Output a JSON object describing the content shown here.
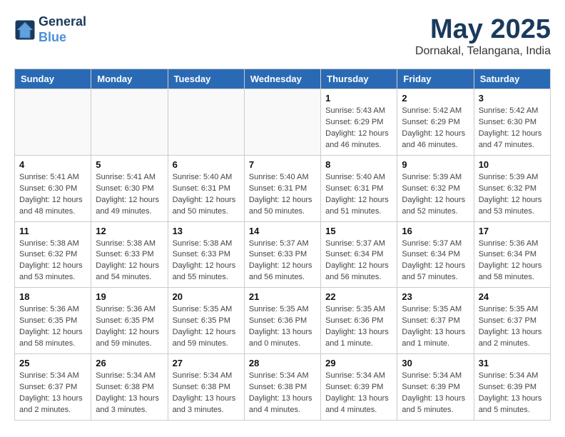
{
  "header": {
    "logo_line1": "General",
    "logo_line2": "Blue",
    "month": "May 2025",
    "location": "Dornakal, Telangana, India"
  },
  "weekdays": [
    "Sunday",
    "Monday",
    "Tuesday",
    "Wednesday",
    "Thursday",
    "Friday",
    "Saturday"
  ],
  "weeks": [
    [
      {
        "day": "",
        "info": ""
      },
      {
        "day": "",
        "info": ""
      },
      {
        "day": "",
        "info": ""
      },
      {
        "day": "",
        "info": ""
      },
      {
        "day": "1",
        "info": "Sunrise: 5:43 AM\nSunset: 6:29 PM\nDaylight: 12 hours\nand 46 minutes."
      },
      {
        "day": "2",
        "info": "Sunrise: 5:42 AM\nSunset: 6:29 PM\nDaylight: 12 hours\nand 46 minutes."
      },
      {
        "day": "3",
        "info": "Sunrise: 5:42 AM\nSunset: 6:30 PM\nDaylight: 12 hours\nand 47 minutes."
      }
    ],
    [
      {
        "day": "4",
        "info": "Sunrise: 5:41 AM\nSunset: 6:30 PM\nDaylight: 12 hours\nand 48 minutes."
      },
      {
        "day": "5",
        "info": "Sunrise: 5:41 AM\nSunset: 6:30 PM\nDaylight: 12 hours\nand 49 minutes."
      },
      {
        "day": "6",
        "info": "Sunrise: 5:40 AM\nSunset: 6:31 PM\nDaylight: 12 hours\nand 50 minutes."
      },
      {
        "day": "7",
        "info": "Sunrise: 5:40 AM\nSunset: 6:31 PM\nDaylight: 12 hours\nand 50 minutes."
      },
      {
        "day": "8",
        "info": "Sunrise: 5:40 AM\nSunset: 6:31 PM\nDaylight: 12 hours\nand 51 minutes."
      },
      {
        "day": "9",
        "info": "Sunrise: 5:39 AM\nSunset: 6:32 PM\nDaylight: 12 hours\nand 52 minutes."
      },
      {
        "day": "10",
        "info": "Sunrise: 5:39 AM\nSunset: 6:32 PM\nDaylight: 12 hours\nand 53 minutes."
      }
    ],
    [
      {
        "day": "11",
        "info": "Sunrise: 5:38 AM\nSunset: 6:32 PM\nDaylight: 12 hours\nand 53 minutes."
      },
      {
        "day": "12",
        "info": "Sunrise: 5:38 AM\nSunset: 6:33 PM\nDaylight: 12 hours\nand 54 minutes."
      },
      {
        "day": "13",
        "info": "Sunrise: 5:38 AM\nSunset: 6:33 PM\nDaylight: 12 hours\nand 55 minutes."
      },
      {
        "day": "14",
        "info": "Sunrise: 5:37 AM\nSunset: 6:33 PM\nDaylight: 12 hours\nand 56 minutes."
      },
      {
        "day": "15",
        "info": "Sunrise: 5:37 AM\nSunset: 6:34 PM\nDaylight: 12 hours\nand 56 minutes."
      },
      {
        "day": "16",
        "info": "Sunrise: 5:37 AM\nSunset: 6:34 PM\nDaylight: 12 hours\nand 57 minutes."
      },
      {
        "day": "17",
        "info": "Sunrise: 5:36 AM\nSunset: 6:34 PM\nDaylight: 12 hours\nand 58 minutes."
      }
    ],
    [
      {
        "day": "18",
        "info": "Sunrise: 5:36 AM\nSunset: 6:35 PM\nDaylight: 12 hours\nand 58 minutes."
      },
      {
        "day": "19",
        "info": "Sunrise: 5:36 AM\nSunset: 6:35 PM\nDaylight: 12 hours\nand 59 minutes."
      },
      {
        "day": "20",
        "info": "Sunrise: 5:35 AM\nSunset: 6:35 PM\nDaylight: 12 hours\nand 59 minutes."
      },
      {
        "day": "21",
        "info": "Sunrise: 5:35 AM\nSunset: 6:36 PM\nDaylight: 13 hours\nand 0 minutes."
      },
      {
        "day": "22",
        "info": "Sunrise: 5:35 AM\nSunset: 6:36 PM\nDaylight: 13 hours\nand 1 minute."
      },
      {
        "day": "23",
        "info": "Sunrise: 5:35 AM\nSunset: 6:37 PM\nDaylight: 13 hours\nand 1 minute."
      },
      {
        "day": "24",
        "info": "Sunrise: 5:35 AM\nSunset: 6:37 PM\nDaylight: 13 hours\nand 2 minutes."
      }
    ],
    [
      {
        "day": "25",
        "info": "Sunrise: 5:34 AM\nSunset: 6:37 PM\nDaylight: 13 hours\nand 2 minutes."
      },
      {
        "day": "26",
        "info": "Sunrise: 5:34 AM\nSunset: 6:38 PM\nDaylight: 13 hours\nand 3 minutes."
      },
      {
        "day": "27",
        "info": "Sunrise: 5:34 AM\nSunset: 6:38 PM\nDaylight: 13 hours\nand 3 minutes."
      },
      {
        "day": "28",
        "info": "Sunrise: 5:34 AM\nSunset: 6:38 PM\nDaylight: 13 hours\nand 4 minutes."
      },
      {
        "day": "29",
        "info": "Sunrise: 5:34 AM\nSunset: 6:39 PM\nDaylight: 13 hours\nand 4 minutes."
      },
      {
        "day": "30",
        "info": "Sunrise: 5:34 AM\nSunset: 6:39 PM\nDaylight: 13 hours\nand 5 minutes."
      },
      {
        "day": "31",
        "info": "Sunrise: 5:34 AM\nSunset: 6:39 PM\nDaylight: 13 hours\nand 5 minutes."
      }
    ]
  ]
}
